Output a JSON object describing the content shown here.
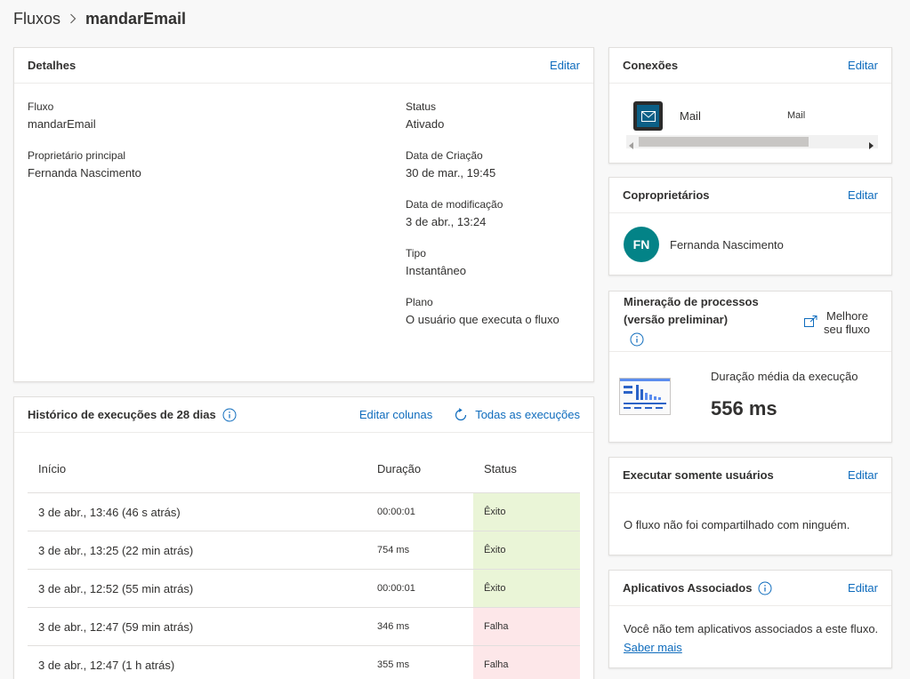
{
  "breadcrumb": {
    "root": "Fluxos",
    "current": "mandarEmail"
  },
  "details": {
    "title": "Detalhes",
    "edit": "Editar",
    "fields": {
      "flow_label": "Fluxo",
      "flow_value": "mandarEmail",
      "owner_label": "Proprietário principal",
      "owner_value": "Fernanda Nascimento",
      "status_label": "Status",
      "status_value": "Ativado",
      "created_label": "Data de Criação",
      "created_value": "30 de mar., 19:45",
      "modified_label": "Data de modificação",
      "modified_value": "3 de abr., 13:24",
      "type_label": "Tipo",
      "type_value": "Instantâneo",
      "plan_label": "Plano",
      "plan_value": "O usuário que executa o fluxo"
    }
  },
  "history": {
    "title": "Histórico de execuções de 28 dias",
    "edit_columns": "Editar colunas",
    "all_runs": "Todas as execuções",
    "columns": [
      "Início",
      "Duração",
      "Status"
    ],
    "rows": [
      {
        "start": "3 de abr., 13:46 (46 s atrás)",
        "duration": "00:00:01",
        "status": "Êxito"
      },
      {
        "start": "3 de abr., 13:25 (22 min atrás)",
        "duration": "754 ms",
        "status": "Êxito"
      },
      {
        "start": "3 de abr., 12:52 (55 min atrás)",
        "duration": "00:00:01",
        "status": "Êxito"
      },
      {
        "start": "3 de abr., 12:47 (59 min atrás)",
        "duration": "346 ms",
        "status": "Falha"
      },
      {
        "start": "3 de abr., 12:47 (1 h atrás)",
        "duration": "355 ms",
        "status": "Falha"
      }
    ]
  },
  "connections": {
    "title": "Conexões",
    "edit": "Editar",
    "name": "Mail",
    "type": "Mail"
  },
  "coowners": {
    "title": "Coproprietários",
    "edit": "Editar",
    "initials": "FN",
    "name": "Fernanda Nascimento"
  },
  "process_mining": {
    "title_line1": "Mineração de processos",
    "title_line2": "(versão preliminar)",
    "improve_line1": "Melhore",
    "improve_line2": "seu fluxo",
    "metric_label": "Duração média da execução",
    "metric_value": "556 ms"
  },
  "run_only": {
    "title": "Executar somente usuários",
    "edit": "Editar",
    "message": "O fluxo não foi compartilhado com ninguém."
  },
  "apps": {
    "title": "Aplicativos Associados",
    "edit": "Editar",
    "message": "Você não tem aplicativos associados a este fluxo.",
    "learn_more": "Saber mais"
  },
  "colors": {
    "accent": "#0f6cbd",
    "success_bg": "#eaf5d7",
    "failure_bg": "#fde7e9",
    "avatar": "#038387",
    "mail_tile": "#0b3f5c"
  }
}
